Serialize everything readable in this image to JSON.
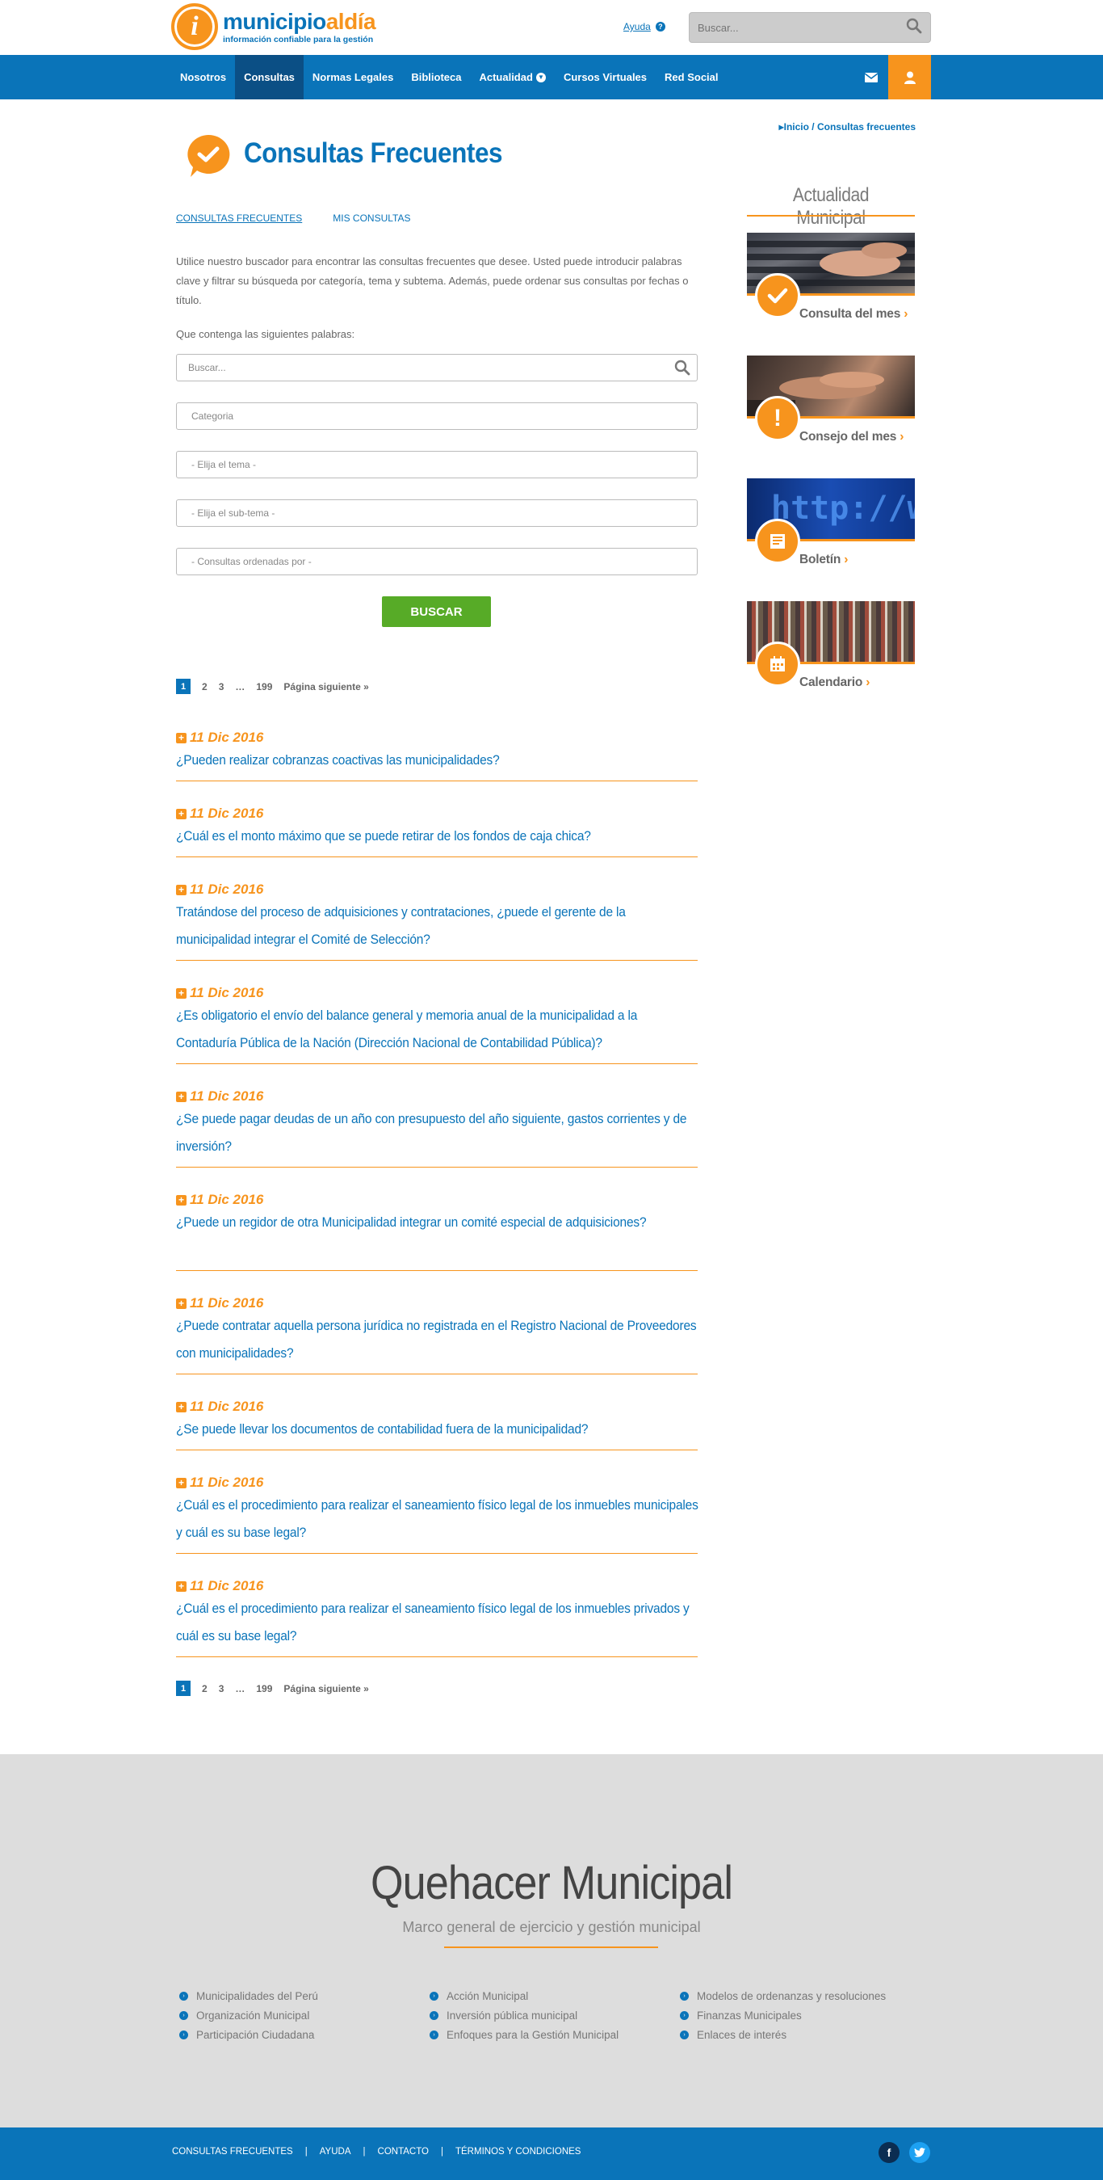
{
  "header": {
    "logo_main": "municipio",
    "logo_accent": "aldía",
    "logo_tagline": "información confiable para la gestión",
    "help_label": "Ayuda",
    "search_placeholder": "Buscar..."
  },
  "nav": {
    "items": [
      {
        "label": "Nosotros"
      },
      {
        "label": "Consultas"
      },
      {
        "label": "Normas Legales"
      },
      {
        "label": "Biblioteca"
      },
      {
        "label": "Actualidad"
      },
      {
        "label": "Cursos Virtuales"
      },
      {
        "label": "Red Social"
      }
    ]
  },
  "breadcrumb": "Inicio / Consultas frecuentes",
  "page": {
    "title": "Consultas Frecuentes",
    "tabs": [
      "CONSULTAS FRECUENTES",
      "MIS CONSULTAS"
    ],
    "intro": "Utilice nuestro buscador para encontrar las consultas frecuentes que desee. Usted puede introducir palabras clave y filtrar su búsqueda por categoría, tema y subtema. Además, puede ordenar sus consultas por fechas o título.",
    "words_label": "Que contenga las siguientes palabras:",
    "search_placeholder": "Buscar...",
    "selects": [
      "Categoria",
      "- Elija el tema -",
      "- Elija el sub-tema -",
      "- Consultas ordenadas por -"
    ],
    "buscar_label": "BUSCAR"
  },
  "pager": {
    "pages": [
      "1",
      "2",
      "3",
      "…",
      "199"
    ],
    "next": "Página siguiente »"
  },
  "faqs": [
    {
      "date": "11 Dic 2016",
      "question": "¿Pueden realizar cobranzas coactivas las municipalidades?"
    },
    {
      "date": "11 Dic 2016",
      "question": "¿Cuál es el monto máximo que se puede retirar de los fondos de caja chica?"
    },
    {
      "date": "11 Dic 2016",
      "question": "Tratándose del proceso de adquisiciones y contrataciones, ¿puede el gerente de la municipalidad integrar el Comité de Selección?"
    },
    {
      "date": "11 Dic 2016",
      "question": "¿Es obligatorio el envío del balance general y memoria anual de la municipalidad a la Contaduría Pública de la Nación (Dirección Nacional de Contabilidad Pública)?"
    },
    {
      "date": "11 Dic 2016",
      "question": "¿Se puede pagar deudas de un año con presupuesto del año siguiente, gastos corrientes y de inversión?"
    },
    {
      "date": "11 Dic 2016",
      "question": "¿Puede un regidor de otra Municipalidad integrar un comité especial de adquisiciones?"
    },
    {
      "date": "11 Dic 2016",
      "question": "¿Puede contratar aquella persona jurídica no registrada en el Registro Nacional de Proveedores con municipalidades?"
    },
    {
      "date": "11 Dic 2016",
      "question": "¿Se puede llevar los documentos de contabilidad fuera de la municipalidad?"
    },
    {
      "date": "11 Dic 2016",
      "question": "¿Cuál es el procedimiento para realizar el saneamiento físico legal de los inmuebles municipales y cuál es su base legal?"
    },
    {
      "date": "11 Dic 2016",
      "question": "¿Cuál es el procedimiento para realizar el saneamiento físico legal de los inmuebles privados y cuál es su base legal?"
    }
  ],
  "sidebar": {
    "title": "Actualidad Municipal",
    "cards": [
      {
        "label": "Consulta del mes",
        "icon": "check-icon"
      },
      {
        "label": "Consejo del mes",
        "icon": "exclamation-icon"
      },
      {
        "label": "Boletín",
        "icon": "newspaper-icon"
      },
      {
        "label": "Calendario",
        "icon": "calendar-icon"
      }
    ]
  },
  "footer": {
    "title": "Quehacer Municipal",
    "subtitle": "Marco general de ejercicio y gestión municipal",
    "columns": [
      [
        "Municipalidades del Perú",
        "Organización Municipal",
        "Participación Ciudadana"
      ],
      [
        "Acción Municipal",
        "Inversión pública municipal",
        "Enfoques para la Gestión Municipal"
      ],
      [
        "Modelos de ordenanzas y resoluciones",
        "Finanzas Municipales",
        "Enlaces de interés"
      ]
    ],
    "links": [
      "CONSULTAS FRECUENTES",
      "AYUDA",
      "CONTACTO",
      "TÉRMINOS Y CONDICIONES"
    ]
  },
  "colors": {
    "brand_blue": "#0a74b9",
    "brand_orange": "#f7941d",
    "button_green": "#57ab27"
  }
}
